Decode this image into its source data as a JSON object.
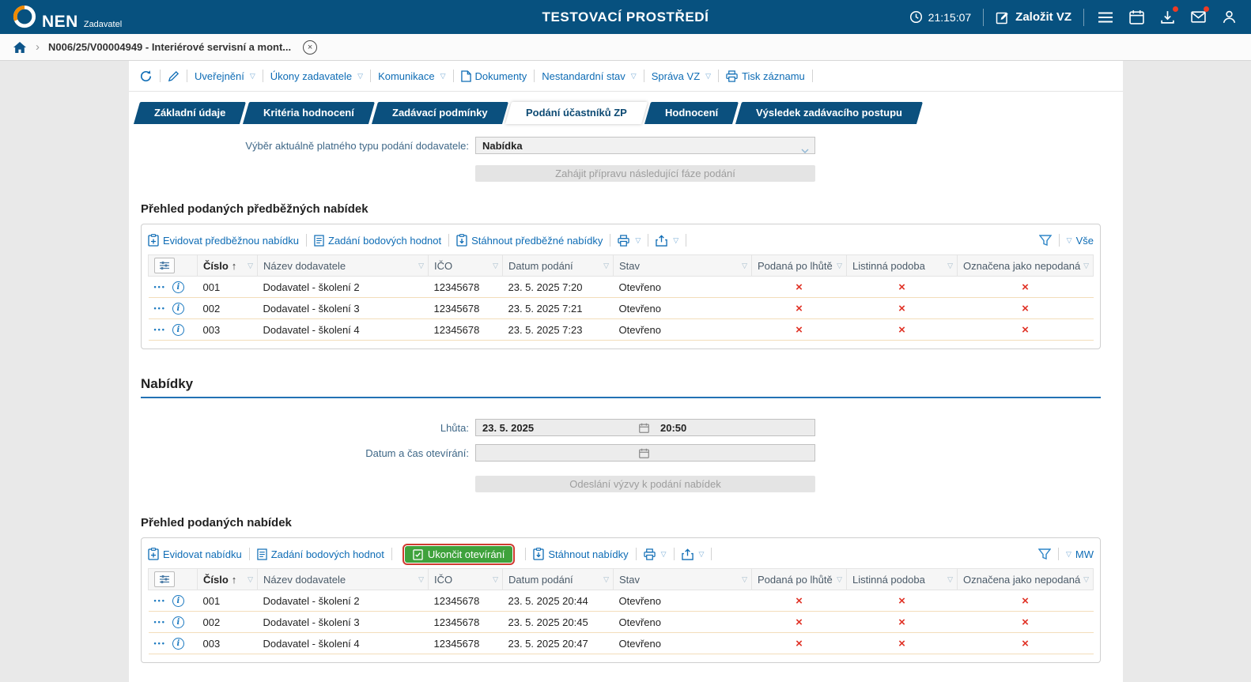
{
  "header": {
    "brand": "NEN",
    "brand_sub": "Zadavatel",
    "env_title": "TESTOVACÍ PROSTŘEDÍ",
    "clock": "21:15:07",
    "create_vz_label": "Založit VZ"
  },
  "breadcrumb": {
    "record_label": "N006/25/V00004949 - Interiérové servisní a mont..."
  },
  "record_toolbar": {
    "items": [
      {
        "label": "Uveřejnění"
      },
      {
        "label": "Úkony zadavatele"
      },
      {
        "label": "Komunikace"
      },
      {
        "label": "Dokumenty"
      },
      {
        "label": "Nestandardní stav"
      },
      {
        "label": "Správa VZ"
      },
      {
        "label": "Tisk záznamu"
      }
    ]
  },
  "tabs": [
    {
      "label": "Základní údaje",
      "active": false
    },
    {
      "label": "Kritéria hodnocení",
      "active": false
    },
    {
      "label": "Zadávací podmínky",
      "active": false
    },
    {
      "label": "Podání účastníků ZP",
      "active": true
    },
    {
      "label": "Hodnocení",
      "active": false
    },
    {
      "label": "Výsledek zadávacího postupu",
      "active": false
    }
  ],
  "submission_panel": {
    "type_select_label": "Výběr aktuálně platného typu podání dodavatele:",
    "type_select_value": "Nabídka",
    "phase_button_label": "Zahájit přípravu následující fáze podání"
  },
  "columns": {
    "cislo": "Číslo",
    "nazev": "Název dodavatele",
    "ico": "IČO",
    "datum": "Datum podání",
    "stav": "Stav",
    "po_lhute": "Podaná po lhůtě",
    "listinna": "Listinná podoba",
    "nepodana": "Označena jako nepodaná"
  },
  "prelim": {
    "heading": "Přehled podaných předběžných nabídek",
    "toolbar": {
      "evidovat": "Evidovat předběžnou nabídku",
      "zadani": "Zadání bodových hodnot",
      "stahnout": "Stáhnout předběžné nabídky",
      "view": "Vše"
    },
    "rows": [
      {
        "cislo": "001",
        "nazev": "Dodavatel - školení 2",
        "ico": "12345678",
        "datum": "23. 5. 2025 7:20",
        "stav": "Otevřeno"
      },
      {
        "cislo": "002",
        "nazev": "Dodavatel - školení 3",
        "ico": "12345678",
        "datum": "23. 5. 2025 7:21",
        "stav": "Otevřeno"
      },
      {
        "cislo": "003",
        "nazev": "Dodavatel - školení 4",
        "ico": "12345678",
        "datum": "23. 5. 2025 7:23",
        "stav": "Otevřeno"
      }
    ]
  },
  "nabidky": {
    "heading": "Nabídky",
    "lhuta_label": "Lhůta:",
    "lhuta_date": "23. 5. 2025",
    "lhuta_time": "20:50",
    "otevirani_label": "Datum a čas otevírání:",
    "send_button_label": "Odeslání výzvy k podání nabídek",
    "overview_heading": "Přehled podaných nabídek",
    "toolbar": {
      "evidovat": "Evidovat nabídku",
      "zadani": "Zadání bodových hodnot",
      "ukoncit": "Ukončit otevírání",
      "stahnout": "Stáhnout nabídky",
      "view": "MW"
    },
    "rows": [
      {
        "cislo": "001",
        "nazev": "Dodavatel - školení 2",
        "ico": "12345678",
        "datum": "23. 5. 2025 20:44",
        "stav": "Otevřeno"
      },
      {
        "cislo": "002",
        "nazev": "Dodavatel - školení 3",
        "ico": "12345678",
        "datum": "23. 5. 2025 20:45",
        "stav": "Otevřeno"
      },
      {
        "cislo": "003",
        "nazev": "Dodavatel - školení 4",
        "ico": "12345678",
        "datum": "23. 5. 2025 20:47",
        "stav": "Otevřeno"
      }
    ]
  },
  "icons": {
    "caret_down": "▽",
    "sort_asc": "↑",
    "row_menu": "•••",
    "info": "i",
    "cross": "×",
    "breadcrumb_chevron": "›",
    "close": "×"
  },
  "colors": {
    "topbar": "#07517f",
    "link_blue": "#0e6cb5",
    "green_button": "#3fa23c",
    "cross_red": "#e03226",
    "highlight_red": "#cf3a30",
    "section_rule": "#2272b4"
  }
}
